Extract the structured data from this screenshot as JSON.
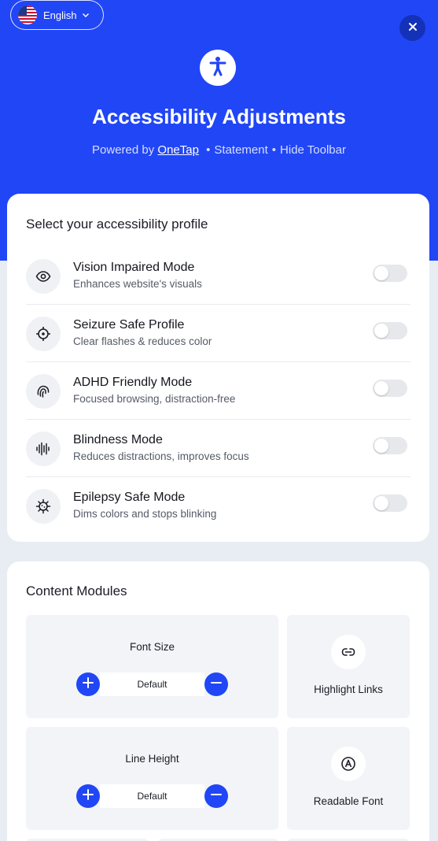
{
  "header": {
    "language_label": "English",
    "title": "Accessibility Adjustments",
    "powered_by": "Powered by",
    "brand_link": "OneTap",
    "separator": "•",
    "statement_link": "Statement",
    "hide_toolbar_link": "Hide Toolbar",
    "background_color": "#2146f6"
  },
  "profiles": {
    "heading": "Select your accessibility profile",
    "items": [
      {
        "name": "Vision Impaired Mode",
        "description": "Enhances website's visuals",
        "icon": "eye-icon",
        "enabled": false
      },
      {
        "name": "Seizure Safe Profile",
        "description": "Clear flashes & reduces color",
        "icon": "crosshair-icon",
        "enabled": false
      },
      {
        "name": "ADHD Friendly Mode",
        "description": "Focused browsing, distraction-free",
        "icon": "fingerprint-icon",
        "enabled": false
      },
      {
        "name": "Blindness Mode",
        "description": "Reduces distractions, improves focus",
        "icon": "audio-wave-icon",
        "enabled": false
      },
      {
        "name": "Epilepsy Safe Mode",
        "description": "Dims colors and stops blinking",
        "icon": "virus-icon",
        "enabled": false
      }
    ]
  },
  "content_modules": {
    "heading": "Content Modules",
    "font_size": {
      "label": "Font Size",
      "value": "Default"
    },
    "line_height": {
      "label": "Line Height",
      "value": "Default"
    },
    "highlight_links": {
      "label": "Highlight Links",
      "icon": "link-icon"
    },
    "readable_font": {
      "label": "Readable Font",
      "icon": "font-a-icon"
    }
  }
}
